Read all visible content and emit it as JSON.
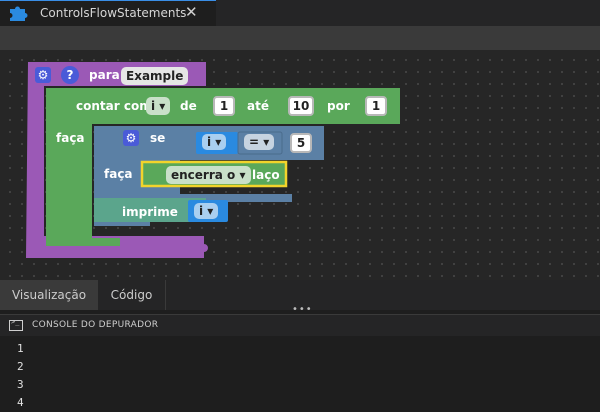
{
  "tab": {
    "title": "ControlsFlowStatements",
    "close": "✕"
  },
  "blocks": {
    "procedure": {
      "keyword": "para",
      "name": "Example"
    },
    "count": {
      "label": "contar com",
      "var": "i",
      "from_label": "de",
      "from": "1",
      "to_label": "até",
      "to": "10",
      "by_label": "por",
      "by": "1"
    },
    "do_label": "faça",
    "if": {
      "label": "se",
      "left": "i",
      "op": "=",
      "right": "5",
      "do_label": "faça"
    },
    "break": {
      "value": "encerra o",
      "suffix": "laço"
    },
    "print": {
      "label": "imprime",
      "var": "i"
    }
  },
  "bottom_tabs": [
    "Visualização",
    "Código"
  ],
  "console": {
    "title": "CONSOLE DO DEPURADOR",
    "lines": [
      "1",
      "2",
      "3",
      "4"
    ]
  },
  "colors": {
    "procedure": "#9b59b6",
    "loop": "#5aa85a",
    "logic": "#5b80a5",
    "variable": "#2a8ae0",
    "print": "#5ba58c"
  }
}
